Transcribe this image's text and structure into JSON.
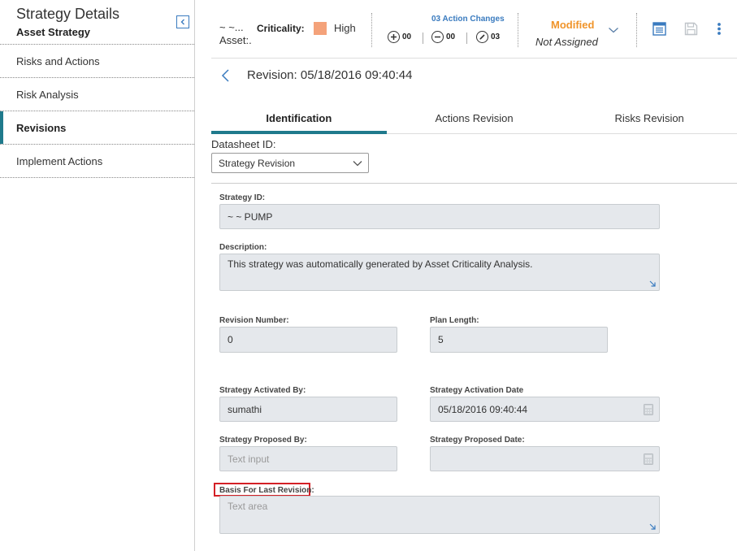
{
  "sidebar": {
    "title": "Strategy Details",
    "subtitle": "Asset Strategy",
    "items": [
      {
        "label": "Risks and Actions"
      },
      {
        "label": "Risk Analysis"
      },
      {
        "label": "Revisions"
      },
      {
        "label": "Implement Actions"
      }
    ]
  },
  "toolbar": {
    "asset_line1": "~ ~...",
    "asset_line2": "Asset:.",
    "criticality_label": "Criticality:",
    "criticality_value": "High",
    "criticality_color": "#f4a27a",
    "action_changes": "03 Action Changes",
    "added": "00",
    "removed": "00",
    "edited": "03",
    "status": "Modified",
    "assigned": "Not Assigned",
    "icons": [
      "plus-circle-icon",
      "minus-circle-icon",
      "pencil-circle-icon",
      "chevron-down-icon",
      "datasheet-icon",
      "save-icon",
      "more-vertical-icon"
    ]
  },
  "revision": {
    "title": "Revision: 05/18/2016 09:40:44"
  },
  "tabs": [
    {
      "label": "Identification"
    },
    {
      "label": "Actions Revision"
    },
    {
      "label": "Risks Revision"
    }
  ],
  "datasheet": {
    "label": "Datasheet ID:",
    "value": "Strategy Revision"
  },
  "form": {
    "strategy_id": {
      "label": "Strategy ID:",
      "value": "~ ~ PUMP"
    },
    "description": {
      "label": "Description:",
      "value": "This strategy was automatically generated by Asset Criticality Analysis."
    },
    "revision_number": {
      "label": "Revision Number:",
      "value": "0"
    },
    "plan_length": {
      "label": "Plan Length:",
      "value": "5"
    },
    "activated_by": {
      "label": "Strategy Activated By:",
      "value": "sumathi"
    },
    "activation_date": {
      "label": "Strategy Activation Date",
      "value": "05/18/2016 09:40:44"
    },
    "proposed_by": {
      "label": "Strategy Proposed By:",
      "placeholder": "Text input"
    },
    "proposed_date": {
      "label": "Strategy Proposed Date:",
      "value": ""
    },
    "basis": {
      "label": "Basis For Last Revision:",
      "placeholder": "Text area"
    }
  },
  "colors": {
    "accent": "#1f7a8c",
    "link": "#3a7bbf",
    "status": "#f0942a",
    "highlight": "#d42026"
  }
}
